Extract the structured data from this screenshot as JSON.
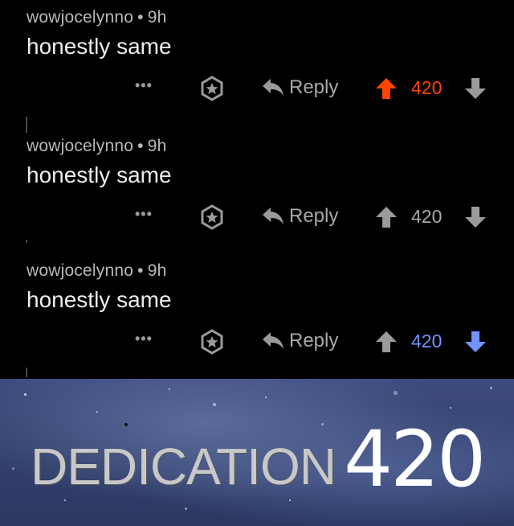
{
  "comments": [
    {
      "username": "wowjocelynno",
      "separator": "•",
      "time": "9h",
      "text": "honestly same",
      "more_label": "•••",
      "reply_label": "Reply",
      "score": "420",
      "vote_state": "upvoted",
      "score_color": "#ff4500"
    },
    {
      "username": "wowjocelynno",
      "separator": "•",
      "time": "9h",
      "text": "honestly same",
      "more_label": "•••",
      "reply_label": "Reply",
      "score": "420",
      "vote_state": "none",
      "score_color": "#a8a8a8"
    },
    {
      "username": "wowjocelynno",
      "separator": "•",
      "time": "9h",
      "text": "honestly same",
      "more_label": "•••",
      "reply_label": "Reply",
      "score": "420",
      "vote_state": "downvoted",
      "score_color": "#7193ff"
    }
  ],
  "colors": {
    "upvote": "#ff4500",
    "downvote": "#7193ff",
    "neutral_icon": "#9a9a9a"
  },
  "banner": {
    "word": "DEDICATION",
    "number": "420"
  }
}
